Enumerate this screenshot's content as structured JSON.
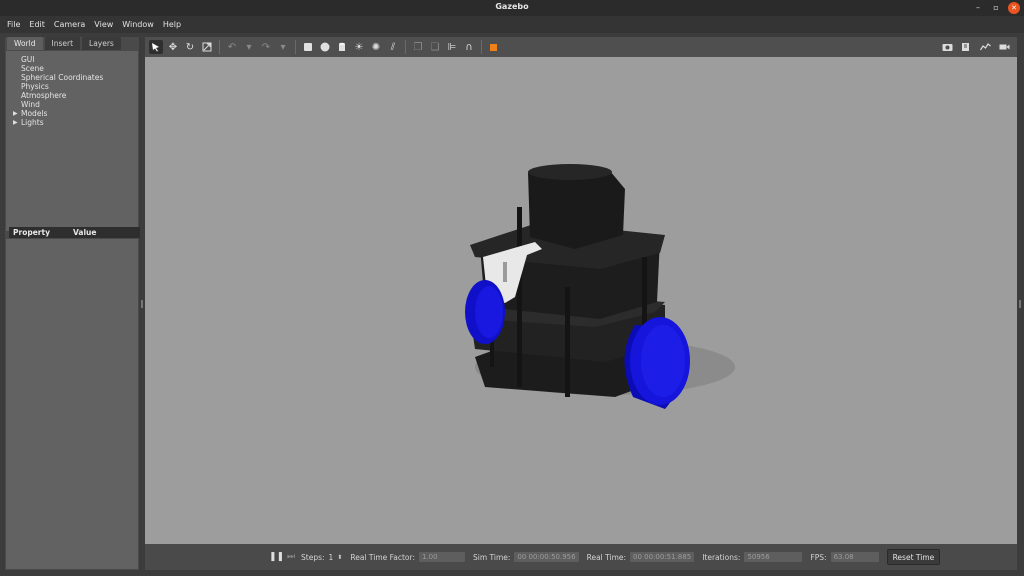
{
  "window": {
    "title": "Gazebo"
  },
  "menu": [
    {
      "label": "File"
    },
    {
      "label": "Edit"
    },
    {
      "label": "Camera"
    },
    {
      "label": "View"
    },
    {
      "label": "Window"
    },
    {
      "label": "Help"
    }
  ],
  "left_panel": {
    "tabs": [
      {
        "label": "World",
        "active": true
      },
      {
        "label": "Insert",
        "active": false
      },
      {
        "label": "Layers",
        "active": false
      }
    ],
    "tree": [
      {
        "label": "GUI",
        "expandable": false
      },
      {
        "label": "Scene",
        "expandable": false
      },
      {
        "label": "Spherical Coordinates",
        "expandable": false
      },
      {
        "label": "Physics",
        "expandable": false
      },
      {
        "label": "Atmosphere",
        "expandable": false
      },
      {
        "label": "Wind",
        "expandable": false
      },
      {
        "label": "Models",
        "expandable": true
      },
      {
        "label": "Lights",
        "expandable": true
      }
    ],
    "property_header": {
      "property": "Property",
      "value": "Value"
    }
  },
  "toolbar": {
    "tools": [
      {
        "icon": "select-arrow-icon",
        "active": true
      },
      {
        "icon": "translate-icon"
      },
      {
        "icon": "rotate-icon"
      },
      {
        "icon": "scale-icon"
      },
      {
        "icon": "undo-icon",
        "dim": true
      },
      {
        "icon": "undo-history-icon",
        "dim": true
      },
      {
        "icon": "redo-icon",
        "dim": true
      },
      {
        "icon": "redo-history-icon",
        "dim": true
      },
      {
        "icon": "box-shape-icon"
      },
      {
        "icon": "sphere-shape-icon"
      },
      {
        "icon": "cylinder-shape-icon"
      },
      {
        "icon": "point-light-icon"
      },
      {
        "icon": "spot-light-icon"
      },
      {
        "icon": "directional-light-icon"
      },
      {
        "icon": "copy-icon",
        "dim": true
      },
      {
        "icon": "paste-icon",
        "dim": true
      },
      {
        "icon": "align-icon"
      },
      {
        "icon": "snap-icon"
      },
      {
        "icon": "change-view-icon",
        "orange": true
      }
    ],
    "right_tools": [
      {
        "icon": "screenshot-icon"
      },
      {
        "icon": "log-icon"
      },
      {
        "icon": "plot-icon"
      },
      {
        "icon": "video-record-icon"
      }
    ]
  },
  "bottom_bar": {
    "steps_label": "Steps:",
    "steps_value": "1",
    "rtf_label": "Real Time Factor:",
    "rtf_value": "1.00",
    "sim_time_label": "Sim Time:",
    "sim_time_value": "00 00:00:50.956",
    "real_time_label": "Real Time:",
    "real_time_value": "00 00:00:51.885",
    "iterations_label": "Iterations:",
    "iterations_value": "50956",
    "fps_label": "FPS:",
    "fps_value": "63.08",
    "reset_label": "Reset Time"
  }
}
